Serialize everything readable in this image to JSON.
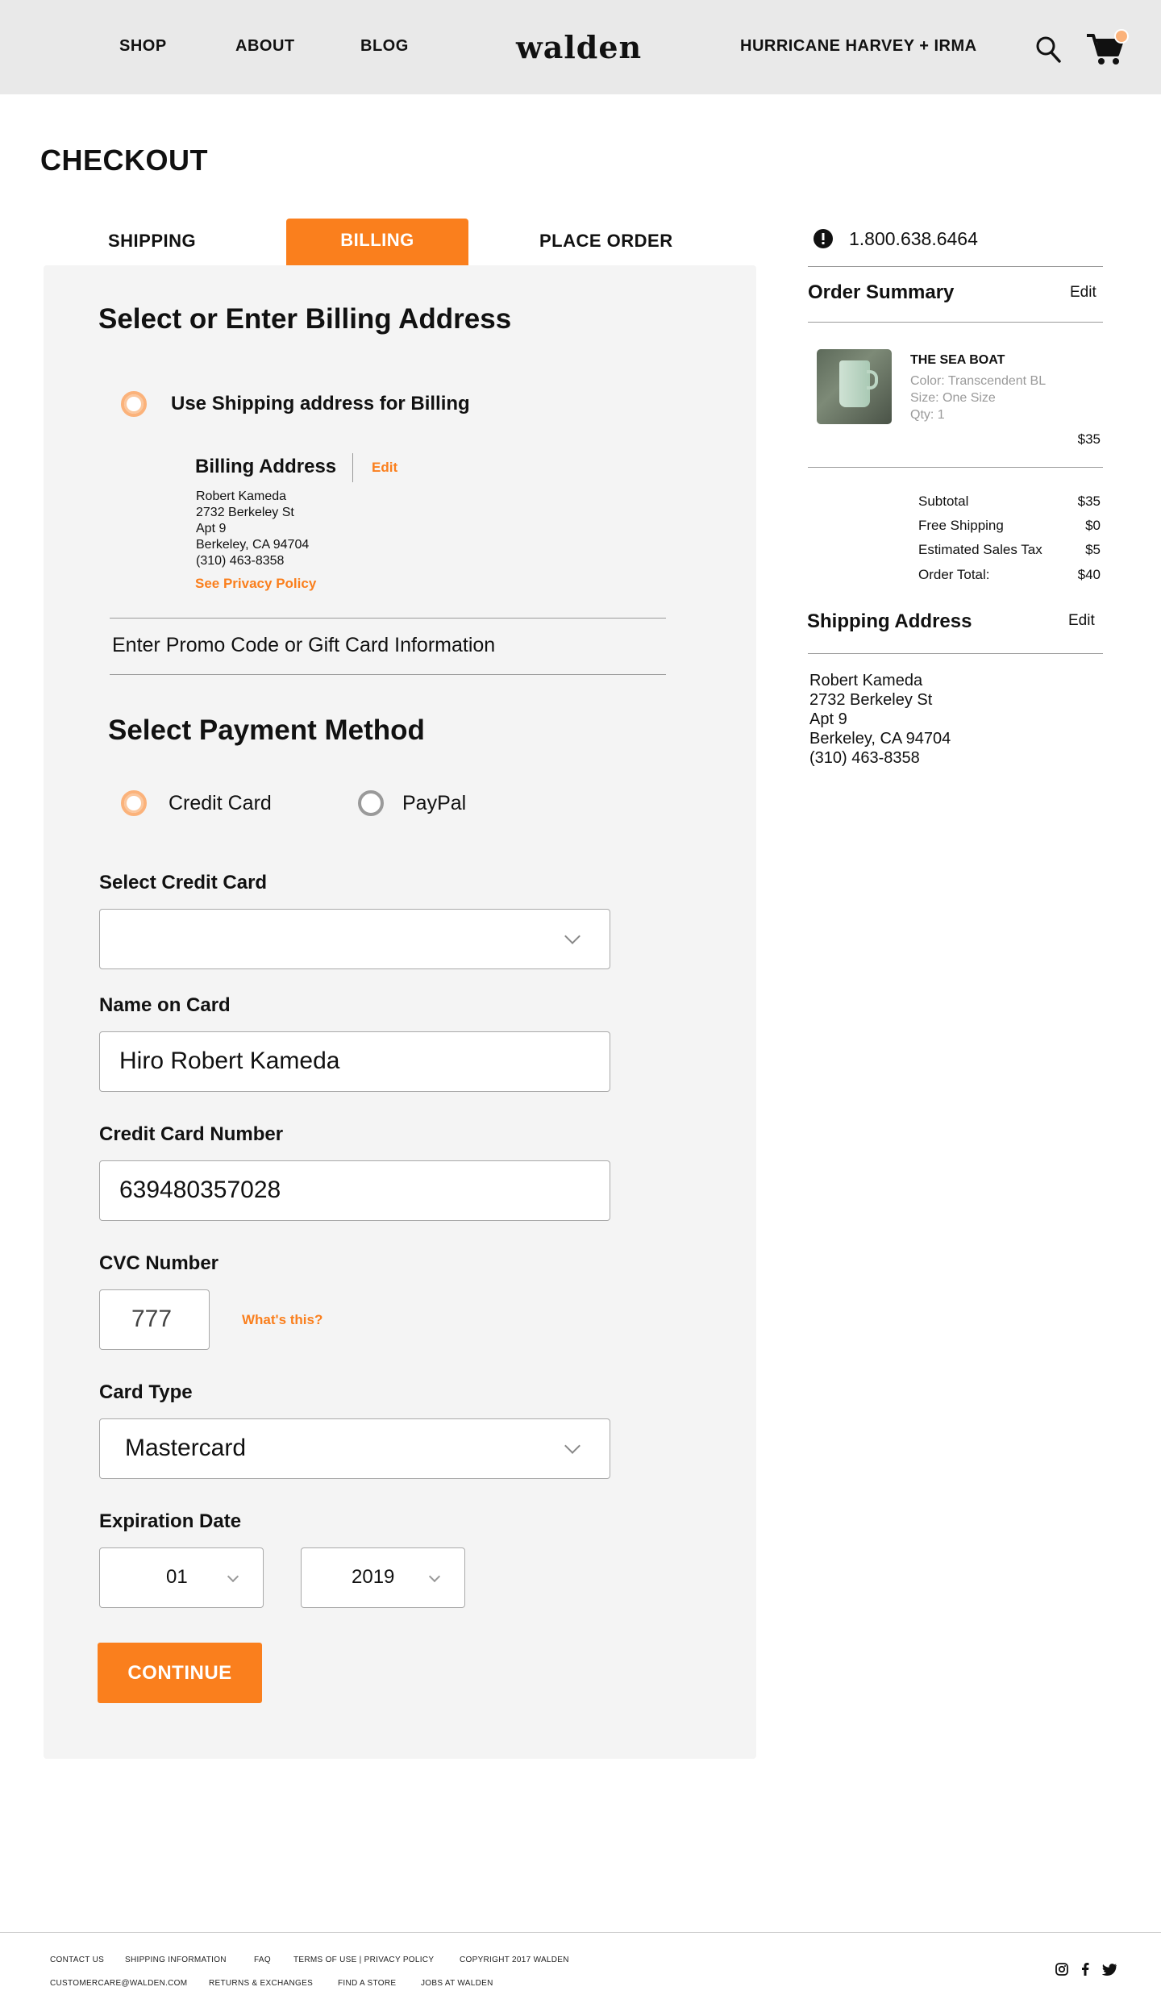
{
  "header": {
    "nav": [
      "SHOP",
      "ABOUT",
      "BLOG"
    ],
    "logo": "walden",
    "promo_link": "HURRICANE HARVEY + IRMA",
    "icons": [
      "search-icon",
      "cart-icon"
    ]
  },
  "page": {
    "title": "CHECKOUT"
  },
  "steps": {
    "shipping": "SHIPPING",
    "billing": "BILLING",
    "place_order": "PLACE ORDER",
    "active": "BILLING"
  },
  "billing": {
    "heading": "Select or Enter Billing Address",
    "use_shipping_label": "Use Shipping address for Billing",
    "address_title": "Billing Address",
    "edit_label": "Edit",
    "address_lines": [
      "Robert Kameda",
      "2732 Berkeley St",
      "Apt 9",
      "Berkeley, CA 94704",
      "(310) 463-8358"
    ],
    "privacy_link": "See Privacy Policy",
    "promo_label": "Enter Promo Code or Gift Card Information"
  },
  "payment": {
    "heading": "Select Payment Method",
    "options": [
      "Credit Card",
      "PayPal"
    ],
    "selected": "Credit Card",
    "select_card_label": "Select Credit Card",
    "select_card_value": "",
    "name_label": "Name on Card",
    "name_value": "Hiro Robert Kameda",
    "number_label": "Credit Card Number",
    "number_value": "639480357028",
    "cvc_label": "CVC Number",
    "cvc_value": "777",
    "cvc_help": "What's this?",
    "type_label": "Card Type",
    "type_value": "Mastercard",
    "exp_label": "Expiration Date",
    "exp_month": "01",
    "exp_year": "2019",
    "continue_label": "CONTINUE"
  },
  "sidebar": {
    "phone": "1.800.638.6464",
    "summary_title": "Order Summary",
    "edit_label": "Edit",
    "product": {
      "name": "THE SEA BOAT",
      "color": "Color: Transcendent BL",
      "size": "Size: One Size",
      "qty": "Qty: 1",
      "price": "$35"
    },
    "totals": [
      {
        "label": "Subtotal",
        "value": "$35"
      },
      {
        "label": "Free Shipping",
        "value": "$0"
      },
      {
        "label": "Estimated Sales Tax",
        "value": "$5"
      },
      {
        "label": "Order Total:",
        "value": "$40"
      }
    ],
    "shipping_title": "Shipping Address",
    "shipping_lines": [
      "Robert Kameda",
      "2732 Berkeley St",
      "Apt 9",
      "Berkeley, CA 94704",
      "(310) 463-8358"
    ]
  },
  "footer": {
    "row1": [
      "CONTACT US",
      "SHIPPING INFORMATION",
      "FAQ",
      "TERMS OF USE | PRIVACY POLICY",
      "COPYRIGHT 2017 WALDEN"
    ],
    "row2": [
      "CUSTOMERCARE@WALDEN.COM",
      "RETURNS & EXCHANGES",
      "FIND A STORE",
      "JOBS AT WALDEN"
    ],
    "social_icons": [
      "instagram-icon",
      "facebook-icon",
      "twitter-icon"
    ]
  },
  "colors": {
    "accent": "#fa7f1d",
    "header_bg": "#e9e9e9",
    "panel_bg": "#f4f4f4"
  }
}
